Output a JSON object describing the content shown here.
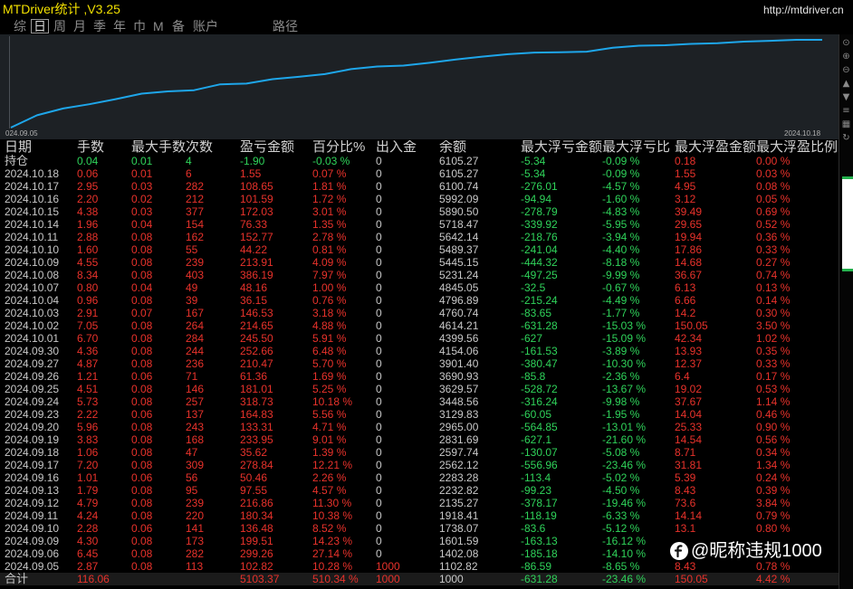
{
  "window": {
    "title": "MTDriver统计 ,V3.25",
    "url": "http://mtdriver.cn"
  },
  "tabs": [
    {
      "label": "综"
    },
    {
      "label": "日",
      "selected": true
    },
    {
      "label": "周"
    },
    {
      "label": "月"
    },
    {
      "label": "季"
    },
    {
      "label": "年"
    },
    {
      "label": "巾"
    },
    {
      "label": "M"
    },
    {
      "label": "备"
    },
    {
      "label": "账户"
    },
    {
      "label": "路径"
    }
  ],
  "equity_chart": {
    "start_label": "024.09.05",
    "end_label": "2024.10.18",
    "scale": "log"
  },
  "toolbar_icons": [
    "pin-icon",
    "zoom-in-icon",
    "zoom-out-icon",
    "up-arrow-icon",
    "down-arrow-icon",
    "list-icon",
    "grid-icon",
    "refresh-icon"
  ],
  "colors": {
    "title": "#f2e000",
    "gain": "#e8322b",
    "loss": "#2fd35a",
    "text": "#c8c8c8",
    "equity_line": "#1ea6ea"
  },
  "table": {
    "headers": [
      "日期",
      "手数",
      "最大手数",
      "次数",
      "盈亏金额",
      "百分比%",
      "出入金",
      "余额",
      "最大浮亏金额",
      "最大浮亏比",
      "最大浮盈金额",
      "最大浮盈比例"
    ],
    "position_row": [
      "持仓",
      "0.04",
      "0.01",
      "4",
      "-1.90",
      "-0.03 %",
      "0",
      "6105.27",
      "-5.34",
      "-0.09 %",
      "0.18",
      "0.00 %"
    ],
    "rows": [
      [
        "2024.10.18",
        "0.06",
        "0.01",
        "6",
        "1.55",
        "0.07 %",
        "0",
        "6105.27",
        "-5.34",
        "-0.09 %",
        "1.55",
        "0.03 %"
      ],
      [
        "2024.10.17",
        "2.95",
        "0.03",
        "282",
        "108.65",
        "1.81 %",
        "0",
        "6100.74",
        "-276.01",
        "-4.57 %",
        "4.95",
        "0.08 %"
      ],
      [
        "2024.10.16",
        "2.20",
        "0.02",
        "212",
        "101.59",
        "1.72 %",
        "0",
        "5992.09",
        "-94.94",
        "-1.60 %",
        "3.12",
        "0.05 %"
      ],
      [
        "2024.10.15",
        "4.38",
        "0.03",
        "377",
        "172.03",
        "3.01 %",
        "0",
        "5890.50",
        "-278.79",
        "-4.83 %",
        "39.49",
        "0.69 %"
      ],
      [
        "2024.10.14",
        "1.96",
        "0.04",
        "154",
        "76.33",
        "1.35 %",
        "0",
        "5718.47",
        "-339.92",
        "-5.95 %",
        "29.65",
        "0.52 %"
      ],
      [
        "2024.10.11",
        "2.88",
        "0.08",
        "162",
        "152.77",
        "2.78 %",
        "0",
        "5642.14",
        "-218.76",
        "-3.94 %",
        "19.94",
        "0.36 %"
      ],
      [
        "2024.10.10",
        "1.60",
        "0.08",
        "55",
        "44.22",
        "0.81 %",
        "0",
        "5489.37",
        "-241.04",
        "-4.40 %",
        "17.86",
        "0.33 %"
      ],
      [
        "2024.10.09",
        "4.55",
        "0.08",
        "239",
        "213.91",
        "4.09 %",
        "0",
        "5445.15",
        "-444.32",
        "-8.18 %",
        "14.68",
        "0.27 %"
      ],
      [
        "2024.10.08",
        "8.34",
        "0.08",
        "403",
        "386.19",
        "7.97 %",
        "0",
        "5231.24",
        "-497.25",
        "-9.99 %",
        "36.67",
        "0.74 %"
      ],
      [
        "2024.10.07",
        "0.80",
        "0.04",
        "49",
        "48.16",
        "1.00 %",
        "0",
        "4845.05",
        "-32.5",
        "-0.67 %",
        "6.13",
        "0.13 %"
      ],
      [
        "2024.10.04",
        "0.96",
        "0.08",
        "39",
        "36.15",
        "0.76 %",
        "0",
        "4796.89",
        "-215.24",
        "-4.49 %",
        "6.66",
        "0.14 %"
      ],
      [
        "2024.10.03",
        "2.91",
        "0.07",
        "167",
        "146.53",
        "3.18 %",
        "0",
        "4760.74",
        "-83.65",
        "-1.77 %",
        "14.2",
        "0.30 %"
      ],
      [
        "2024.10.02",
        "7.05",
        "0.08",
        "264",
        "214.65",
        "4.88 %",
        "0",
        "4614.21",
        "-631.28",
        "-15.03 %",
        "150.05",
        "3.50 %"
      ],
      [
        "2024.10.01",
        "6.70",
        "0.08",
        "284",
        "245.50",
        "5.91 %",
        "0",
        "4399.56",
        "-627",
        "-15.09 %",
        "42.34",
        "1.02 %"
      ],
      [
        "2024.09.30",
        "4.36",
        "0.08",
        "244",
        "252.66",
        "6.48 %",
        "0",
        "4154.06",
        "-161.53",
        "-3.89 %",
        "13.93",
        "0.35 %"
      ],
      [
        "2024.09.27",
        "4.87",
        "0.08",
        "236",
        "210.47",
        "5.70 %",
        "0",
        "3901.40",
        "-380.47",
        "-10.30 %",
        "12.37",
        "0.33 %"
      ],
      [
        "2024.09.26",
        "1.21",
        "0.06",
        "71",
        "61.36",
        "1.69 %",
        "0",
        "3690.93",
        "-85.8",
        "-2.36 %",
        "6.4",
        "0.17 %"
      ],
      [
        "2024.09.25",
        "4.51",
        "0.08",
        "146",
        "181.01",
        "5.25 %",
        "0",
        "3629.57",
        "-528.72",
        "-13.67 %",
        "19.02",
        "0.53 %"
      ],
      [
        "2024.09.24",
        "5.73",
        "0.08",
        "257",
        "318.73",
        "10.18 %",
        "0",
        "3448.56",
        "-316.24",
        "-9.98 %",
        "37.67",
        "1.14 %"
      ],
      [
        "2024.09.23",
        "2.22",
        "0.06",
        "137",
        "164.83",
        "5.56 %",
        "0",
        "3129.83",
        "-60.05",
        "-1.95 %",
        "14.04",
        "0.46 %"
      ],
      [
        "2024.09.20",
        "5.96",
        "0.08",
        "243",
        "133.31",
        "4.71 %",
        "0",
        "2965.00",
        "-564.85",
        "-13.01 %",
        "25.33",
        "0.90 %"
      ],
      [
        "2024.09.19",
        "3.83",
        "0.08",
        "168",
        "233.95",
        "9.01 %",
        "0",
        "2831.69",
        "-627.1",
        "-21.60 %",
        "14.54",
        "0.56 %"
      ],
      [
        "2024.09.18",
        "1.06",
        "0.08",
        "47",
        "35.62",
        "1.39 %",
        "0",
        "2597.74",
        "-130.07",
        "-5.08 %",
        "8.71",
        "0.34 %"
      ],
      [
        "2024.09.17",
        "7.20",
        "0.08",
        "309",
        "278.84",
        "12.21 %",
        "0",
        "2562.12",
        "-556.96",
        "-23.46 %",
        "31.81",
        "1.34 %"
      ],
      [
        "2024.09.16",
        "1.01",
        "0.06",
        "56",
        "50.46",
        "2.26 %",
        "0",
        "2283.28",
        "-113.4",
        "-5.02 %",
        "5.39",
        "0.24 %"
      ],
      [
        "2024.09.13",
        "1.79",
        "0.08",
        "95",
        "97.55",
        "4.57 %",
        "0",
        "2232.82",
        "-99.23",
        "-4.50 %",
        "8.43",
        "0.39 %"
      ],
      [
        "2024.09.12",
        "4.79",
        "0.08",
        "239",
        "216.86",
        "11.30 %",
        "0",
        "2135.27",
        "-378.17",
        "-19.46 %",
        "73.6",
        "3.84 %"
      ],
      [
        "2024.09.11",
        "4.24",
        "0.08",
        "220",
        "180.34",
        "10.38 %",
        "0",
        "1918.41",
        "-118.19",
        "-6.33 %",
        "14.14",
        "0.79 %"
      ],
      [
        "2024.09.10",
        "2.28",
        "0.06",
        "141",
        "136.48",
        "8.52 %",
        "0",
        "1738.07",
        "-83.6",
        "-5.12 %",
        "13.1",
        "0.80 %"
      ],
      [
        "2024.09.09",
        "4.30",
        "0.08",
        "173",
        "199.51",
        "14.23 %",
        "0",
        "1601.59",
        "-163.13",
        "-16.12 %",
        "",
        ""
      ],
      [
        "2024.09.06",
        "6.45",
        "0.08",
        "282",
        "299.26",
        "27.14 %",
        "0",
        "1402.08",
        "-185.18",
        "-14.10 %",
        "",
        ""
      ],
      [
        "2024.09.05",
        "2.87",
        "0.08",
        "113",
        "102.82",
        "10.28 %",
        "1000",
        "1102.82",
        "-86.59",
        "-8.65 %",
        "8.43",
        "0.78 %"
      ]
    ],
    "total_row": [
      "合计",
      "116.06",
      "",
      "",
      "5103.37",
      "510.34 %",
      "1000",
      "1000",
      "-631.28",
      "-23.46 %",
      "150.05",
      "4.42 %"
    ]
  },
  "watermark": {
    "text": "@昵称违规1000",
    "icon": "watermark-logo-icon"
  }
}
